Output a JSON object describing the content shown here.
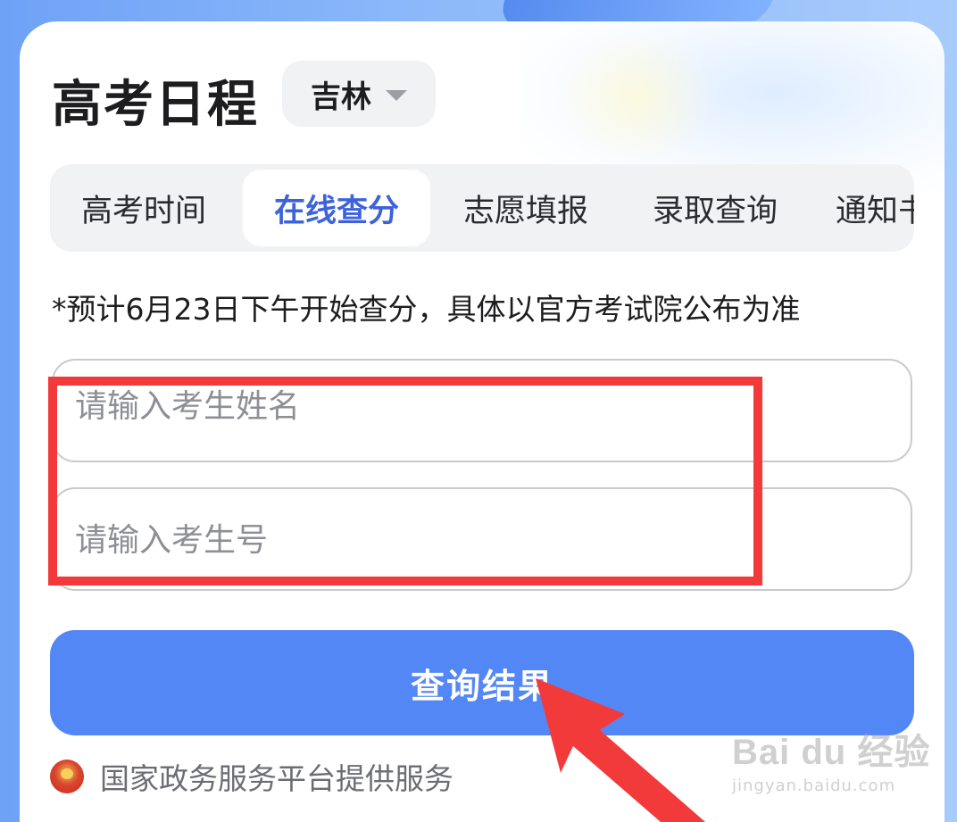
{
  "header": {
    "title": "高考日程",
    "region": "吉林"
  },
  "tabs": [
    {
      "label": "高考时间",
      "active": false
    },
    {
      "label": "在线查分",
      "active": true
    },
    {
      "label": "志愿填报",
      "active": false
    },
    {
      "label": "录取查询",
      "active": false
    },
    {
      "label": "通知书",
      "active": false
    }
  ],
  "notice": "*预计6月23日下午开始查分，具体以官方考试院公布为准",
  "form": {
    "name_placeholder": "请输入考生姓名",
    "name_value": "",
    "id_placeholder": "请输入考生号",
    "id_value": "",
    "submit_label": "查询结果"
  },
  "footer": {
    "text": "国家政务服务平台提供服务",
    "icon": "national-emblem-icon"
  },
  "watermark": {
    "brand": "Bai du 经验",
    "url": "jingyan.baidu.com"
  },
  "colors": {
    "accent": "#5487f6",
    "active_tab_text": "#3d63dc",
    "annotation": "#f23a3b"
  }
}
